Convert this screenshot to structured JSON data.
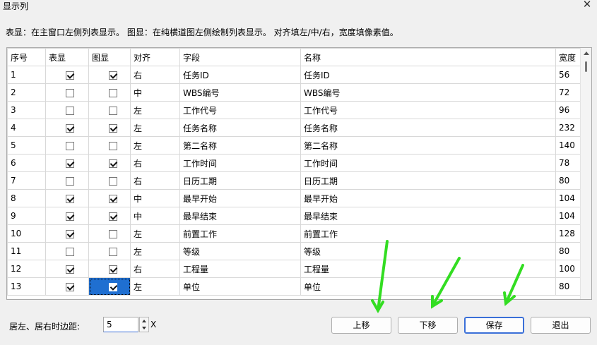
{
  "window": {
    "title": "显示列",
    "close_glyph": "✕"
  },
  "description": "表显：在主窗口左侧列表显示。  图显：在纯横道图左侧绘制列表显示。  对齐填左/中/右，宽度填像素值。",
  "table": {
    "headers": [
      "序号",
      "表显",
      "图显",
      "对齐",
      "字段",
      "名称",
      "宽度"
    ],
    "rows": [
      {
        "index": "1",
        "table_show": true,
        "chart_show": true,
        "align": "右",
        "field": "任务ID",
        "name": "任务ID",
        "width": "56"
      },
      {
        "index": "2",
        "table_show": false,
        "chart_show": false,
        "align": "中",
        "field": "WBS编号",
        "name": "WBS编号",
        "width": "72"
      },
      {
        "index": "3",
        "table_show": false,
        "chart_show": false,
        "align": "左",
        "field": "工作代号",
        "name": "工作代号",
        "width": "96"
      },
      {
        "index": "4",
        "table_show": true,
        "chart_show": true,
        "align": "左",
        "field": "任务名称",
        "name": "任务名称",
        "width": "232"
      },
      {
        "index": "5",
        "table_show": false,
        "chart_show": false,
        "align": "左",
        "field": "第二名称",
        "name": "第二名称",
        "width": "140"
      },
      {
        "index": "6",
        "table_show": true,
        "chart_show": true,
        "align": "右",
        "field": "工作时间",
        "name": "工作时间",
        "width": "78"
      },
      {
        "index": "7",
        "table_show": false,
        "chart_show": false,
        "align": "右",
        "field": "日历工期",
        "name": "日历工期",
        "width": "80"
      },
      {
        "index": "8",
        "table_show": true,
        "chart_show": true,
        "align": "中",
        "field": "最早开始",
        "name": "最早开始",
        "width": "104"
      },
      {
        "index": "9",
        "table_show": true,
        "chart_show": true,
        "align": "中",
        "field": "最早结束",
        "name": "最早结束",
        "width": "104"
      },
      {
        "index": "10",
        "table_show": true,
        "chart_show": false,
        "align": "左",
        "field": "前置工作",
        "name": "前置工作",
        "width": "128"
      },
      {
        "index": "11",
        "table_show": false,
        "chart_show": false,
        "align": "左",
        "field": "等级",
        "name": "等级",
        "width": "80"
      },
      {
        "index": "12",
        "table_show": true,
        "chart_show": true,
        "align": "右",
        "field": "工程量",
        "name": "工程量",
        "width": "100"
      },
      {
        "index": "13",
        "table_show": true,
        "chart_show": true,
        "align": "左",
        "field": "单位",
        "name": "单位",
        "width": "80",
        "selected_cell": "chart_show"
      }
    ]
  },
  "margin": {
    "label": "居左、居右时边距:",
    "value": "5",
    "unit": "X"
  },
  "buttons": {
    "move_up": "上移",
    "move_down": "下移",
    "save": "保存",
    "exit": "退出"
  },
  "annotation_color": "#33dd22"
}
